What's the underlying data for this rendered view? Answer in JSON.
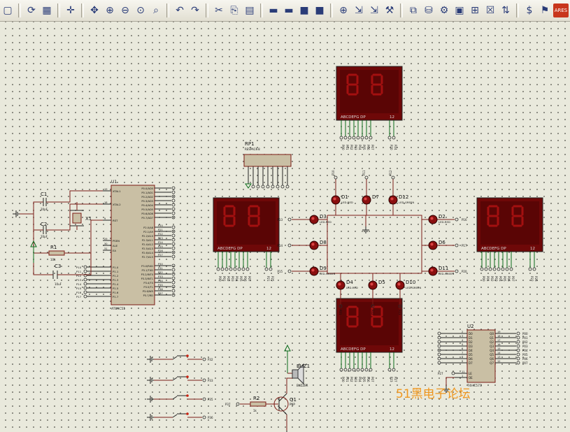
{
  "toolbar": {
    "buttons": [
      {
        "name": "page-icon",
        "glyph": "▢"
      },
      {
        "name": "refresh-icon",
        "glyph": "⟳"
      },
      {
        "name": "grid-icon",
        "glyph": "▦"
      },
      {
        "name": "origin-icon",
        "glyph": "✛"
      },
      {
        "name": "pan-icon",
        "glyph": "✥"
      },
      {
        "name": "zoom-in-icon",
        "glyph": "⊕"
      },
      {
        "name": "zoom-out-icon",
        "glyph": "⊖"
      },
      {
        "name": "zoom-all-icon",
        "glyph": "⊙"
      },
      {
        "name": "zoom-area-icon",
        "glyph": "⌕"
      },
      {
        "name": "undo-icon",
        "glyph": "↶"
      },
      {
        "name": "redo-icon",
        "glyph": "↷"
      },
      {
        "name": "cut-icon",
        "glyph": "✂"
      },
      {
        "name": "copy-icon",
        "glyph": "⎘"
      },
      {
        "name": "paste-icon",
        "glyph": "▤"
      },
      {
        "name": "block-copy-icon",
        "glyph": "▬"
      },
      {
        "name": "block-move-icon",
        "glyph": "▬"
      },
      {
        "name": "block-rotate-icon",
        "glyph": "■"
      },
      {
        "name": "block-delete-icon",
        "glyph": "■"
      },
      {
        "name": "pick-device-icon",
        "glyph": "⊕"
      },
      {
        "name": "make-device-icon",
        "glyph": "⇲"
      },
      {
        "name": "packaging-icon",
        "glyph": "⇲"
      },
      {
        "name": "decompose-icon",
        "glyph": "⚒"
      },
      {
        "name": "wire-autorouter-icon",
        "glyph": "⧉"
      },
      {
        "name": "search-icon",
        "glyph": "⛁"
      },
      {
        "name": "property-tool-icon",
        "glyph": "⚙"
      },
      {
        "name": "design-explorer-icon",
        "glyph": "▣"
      },
      {
        "name": "new-sheet-icon",
        "glyph": "⊞"
      },
      {
        "name": "remove-sheet-icon",
        "glyph": "☒"
      },
      {
        "name": "exit-to-parent-icon",
        "glyph": "⇅"
      },
      {
        "name": "bill-of-materials-icon",
        "glyph": "$"
      },
      {
        "name": "erc-icon",
        "glyph": "⚑"
      },
      {
        "name": "ares-icon",
        "glyph": "ARES"
      }
    ]
  },
  "schematic": {
    "mcu": {
      "ref": "U1",
      "part": "AT89C51",
      "left_pins": [
        "XTAL1",
        "XTAL2",
        "RST",
        "PSEN",
        "ALE",
        "EA"
      ],
      "left_pin_nums": [
        "19",
        "18",
        "9",
        "29",
        "30",
        "31"
      ],
      "p1_pins": [
        "P1.0",
        "P1.1",
        "P1.2",
        "P1.3",
        "P1.4",
        "P1.5",
        "P1.6",
        "P1.7"
      ],
      "p1_nets": [
        "P10",
        "P11",
        "P12",
        "P13",
        "P14",
        "P15",
        "P16",
        "P17"
      ],
      "p0_pins": [
        "P0.0/AD0",
        "P0.1/AD1",
        "P0.2/AD2",
        "P0.3/AD3",
        "P0.4/AD4",
        "P0.5/AD5",
        "P0.6/AD6",
        "P0.7/AD7"
      ],
      "p2_pins": [
        "P2.0/A8",
        "P2.1/A9",
        "P2.2/A10",
        "P2.3/A11",
        "P2.4/A12",
        "P2.5/A13",
        "P2.6/A14",
        "P2.7/A15"
      ],
      "p2_nets": [
        "P20",
        "P21",
        "P22",
        "P23",
        "P24",
        "P25",
        "P26",
        "P27"
      ],
      "p3_pins": [
        "P3.0/RXD",
        "P3.1/TXD",
        "P3.2/INT0",
        "P3.3/INT1",
        "P3.4/T0",
        "P3.5/T1",
        "P3.6/WR",
        "P3.7/RD"
      ],
      "p3_nets": [
        "P30",
        "P31",
        "P32",
        "P33",
        "P34",
        "P35",
        "P36",
        "P37"
      ]
    },
    "passives": {
      "c1": "C1",
      "c1_val": "20pF",
      "c2": "C2",
      "c2_val": "20pF",
      "x1": "X1",
      "r1": "R1",
      "r1_val": "10k",
      "c3": "C3",
      "c3_val": "10uF",
      "rp1": "RP1",
      "rp1_val": "RESPACK-8",
      "r2": "R2",
      "r2_val": "1k",
      "q1": "Q1",
      "q1_val": "PNP",
      "buz": "BUZ1",
      "buz_val": "BUZZER"
    },
    "displays": {
      "seg_label": "ABCDEFG DP",
      "digit_label": "12"
    },
    "leds": {
      "items": [
        {
          "ref": "D1",
          "type": "LED-RED"
        },
        {
          "ref": "D7",
          "type": ""
        },
        {
          "ref": "D12",
          "type": "LED-GREEN"
        },
        {
          "ref": "D3",
          "type": "LED-RED"
        },
        {
          "ref": "D2",
          "type": "LED-RED"
        },
        {
          "ref": "D8",
          "type": ""
        },
        {
          "ref": "D6",
          "type": ""
        },
        {
          "ref": "D9",
          "type": "LED-GREEN"
        },
        {
          "ref": "D11",
          "type": "LED-GREEN"
        },
        {
          "ref": "D4",
          "type": "LED-RED"
        },
        {
          "ref": "D5",
          "type": ""
        },
        {
          "ref": "D10",
          "type": "LED-GREEN"
        }
      ]
    },
    "latch": {
      "ref": "U2",
      "part": "74HC573",
      "d_pins": [
        "D0",
        "D1",
        "D2",
        "D3",
        "D4",
        "D5",
        "D6",
        "D7"
      ],
      "q_pins": [
        "Q0",
        "Q1",
        "Q2",
        "Q3",
        "Q4",
        "Q5",
        "Q6",
        "Q7"
      ],
      "ctrl_pins": [
        "LE",
        "OE"
      ],
      "in_nums": [
        "2",
        "3",
        "4",
        "5",
        "6",
        "7",
        "8",
        "9"
      ],
      "out_nums": [
        "19",
        "18",
        "17",
        "16",
        "15",
        "14",
        "13",
        "12"
      ],
      "ctrl_nums": [
        "11",
        "1"
      ],
      "out_nets": [
        "P00",
        "P01",
        "P02",
        "P03",
        "P04",
        "P05",
        "P06",
        "P07"
      ],
      "le_net": "P27"
    },
    "buttons_nets": [
      "P32",
      "P33",
      "P35",
      "P36"
    ],
    "nets": {
      "p14": "P14",
      "p15": "P15",
      "p16": "P16",
      "p37": "P37"
    }
  },
  "watermark": "51黑电子论坛"
}
